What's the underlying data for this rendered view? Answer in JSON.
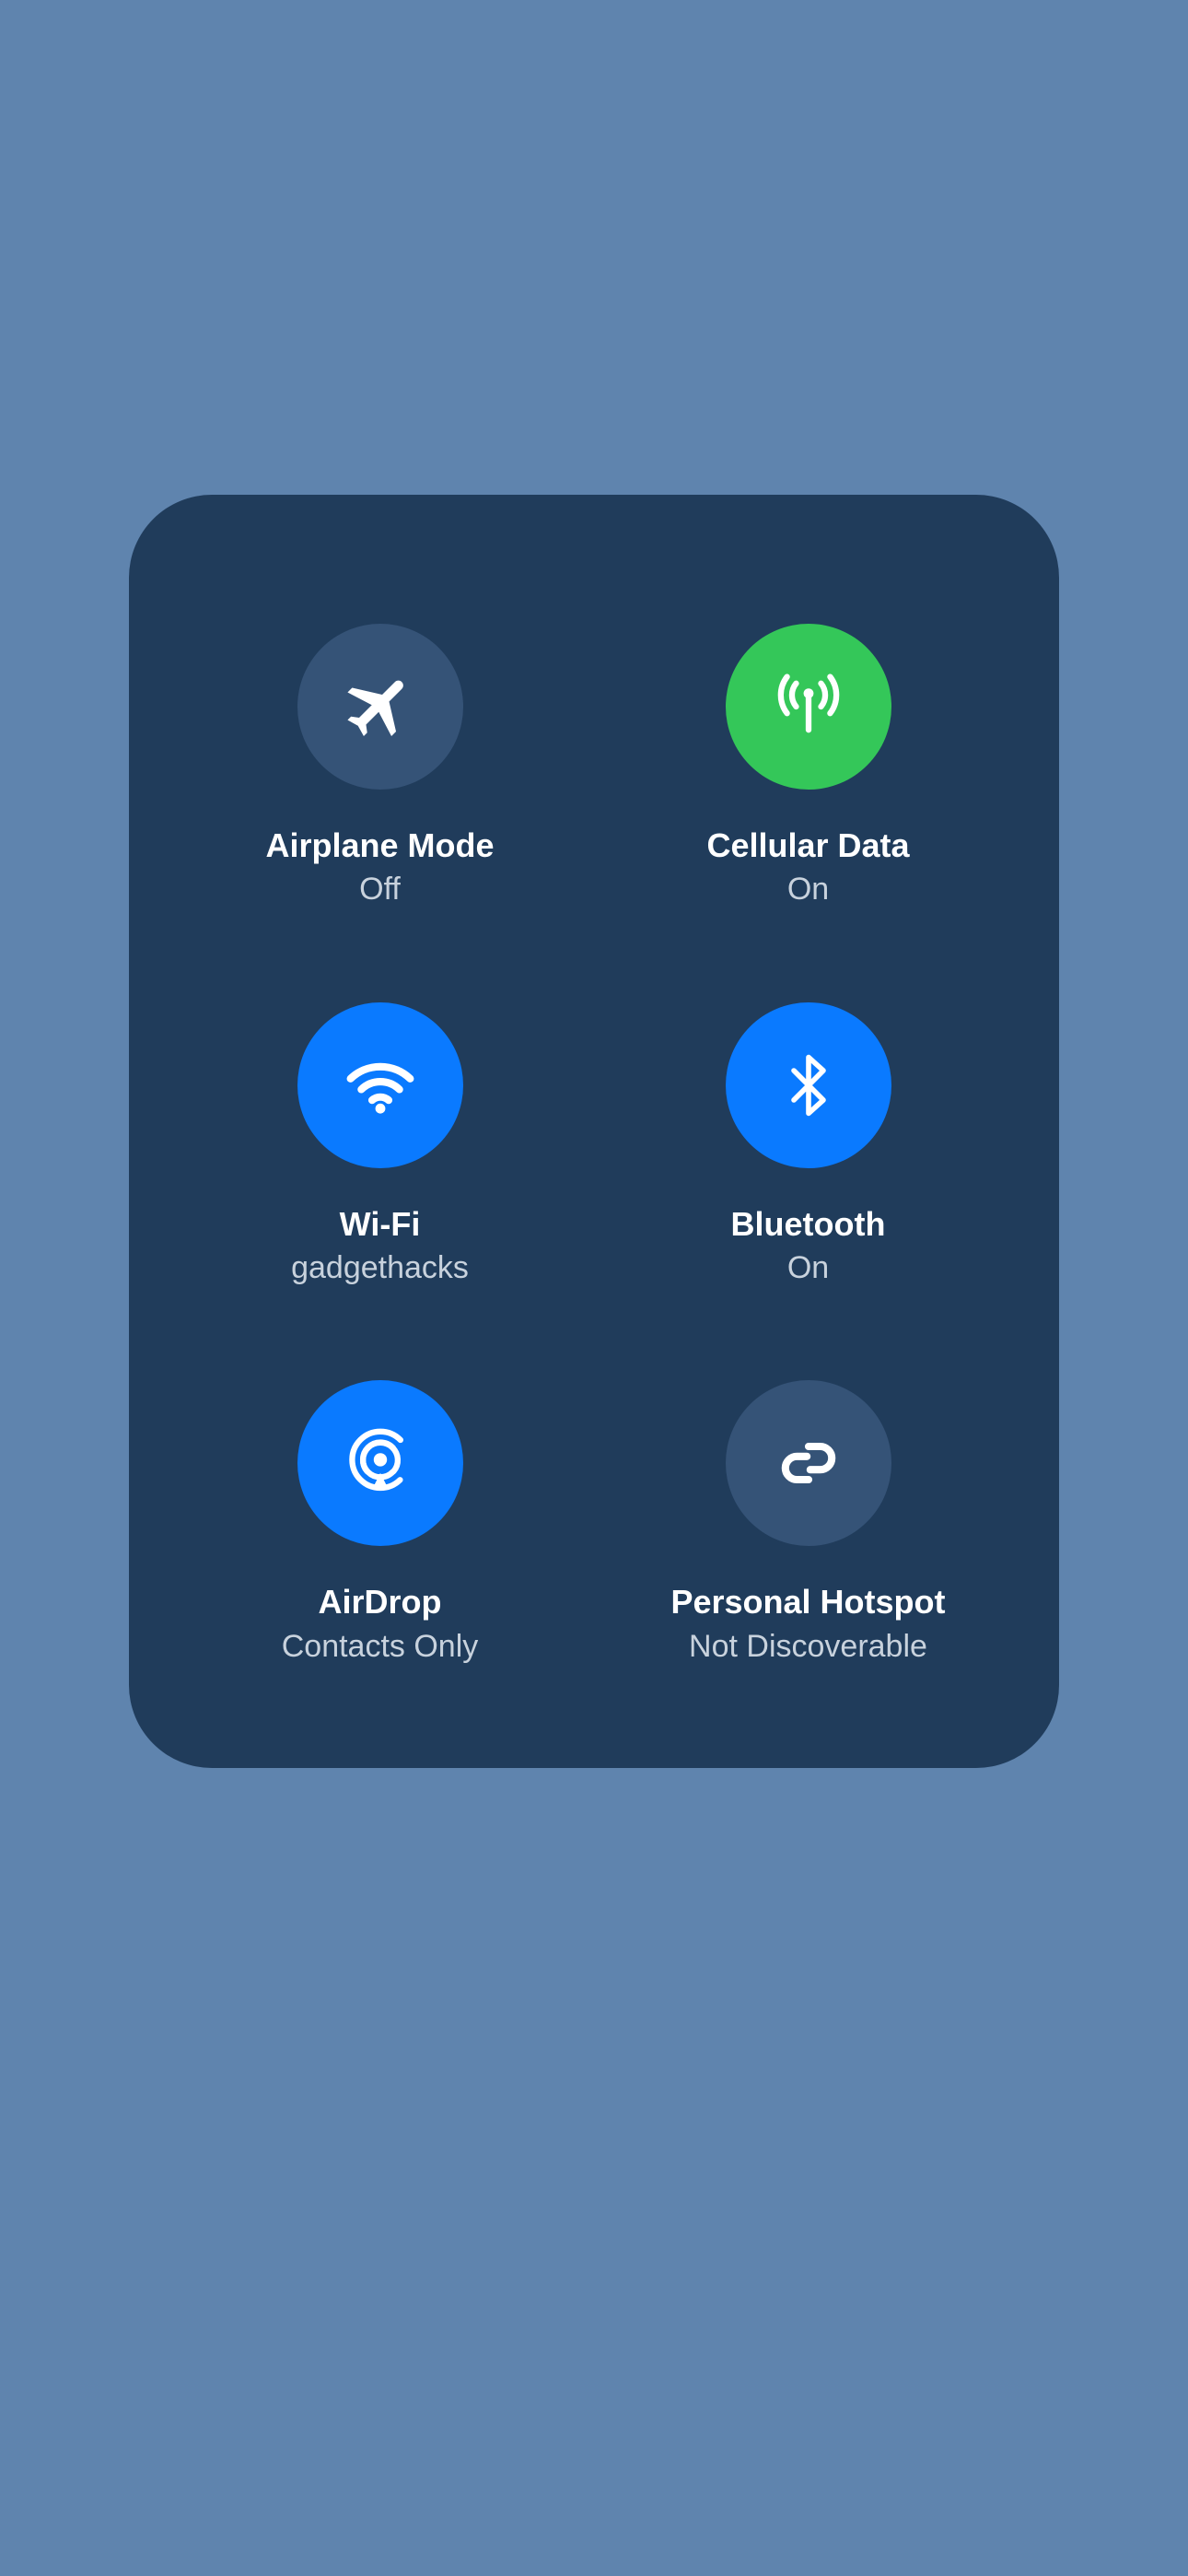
{
  "controls": {
    "airplane": {
      "label": "Airplane Mode",
      "status": "Off",
      "state": "off",
      "button_color_class": "off"
    },
    "cellular": {
      "label": "Cellular Data",
      "status": "On",
      "state": "on",
      "button_color_class": "green"
    },
    "wifi": {
      "label": "Wi-Fi",
      "status": "gadgethacks",
      "state": "on",
      "button_color_class": "blue"
    },
    "bluetooth": {
      "label": "Bluetooth",
      "status": "On",
      "state": "on",
      "button_color_class": "blue"
    },
    "airdrop": {
      "label": "AirDrop",
      "status": "Contacts Only",
      "state": "on",
      "button_color_class": "blue"
    },
    "hotspot": {
      "label": "Personal Hotspot",
      "status": "Not Discoverable",
      "state": "off",
      "button_color_class": "off"
    }
  },
  "colors": {
    "background": "#5F84AE",
    "panel": "#203C5B",
    "toggle_off": "#355377",
    "toggle_green": "#34C759",
    "toggle_blue": "#0A7AFF",
    "label_text": "#FFFFFF",
    "status_text": "#C8D2DD"
  }
}
